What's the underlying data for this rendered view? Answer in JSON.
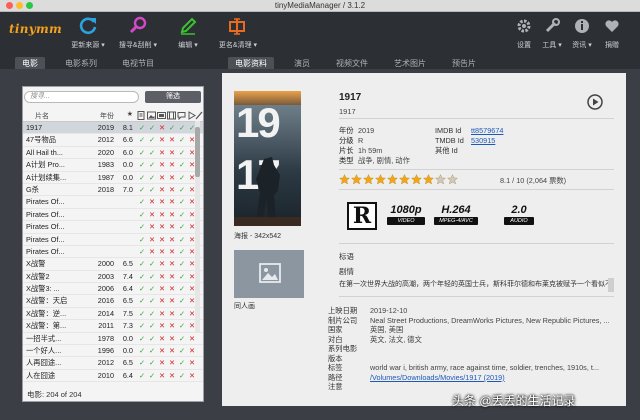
{
  "window": {
    "title": "tinyMediaManager / 3.1.2"
  },
  "toolbar": {
    "logo": "tinymm",
    "buttons": [
      {
        "label": "更新来源 ▾",
        "icon": "refresh-icon",
        "color": "#2aa3e0"
      },
      {
        "label": "搜寻&刮削 ▾",
        "icon": "search-icon",
        "color": "#d548c9"
      },
      {
        "label": "编辑 ▾",
        "icon": "pencil-icon",
        "color": "#39c42f"
      },
      {
        "label": "更名&清理 ▾",
        "icon": "rename-icon",
        "color": "#ea6b1f"
      }
    ],
    "right_buttons": [
      {
        "label": "设置",
        "icon": "gear-icon"
      },
      {
        "label": "工具 ▾",
        "icon": "wrench-icon"
      },
      {
        "label": "资讯 ▾",
        "icon": "info-icon"
      },
      {
        "label": "捐赠",
        "icon": "heart-icon"
      }
    ]
  },
  "left_tabs": [
    "电影",
    "电影系列",
    "电视节目"
  ],
  "right_tabs": [
    "电影资料",
    "演员",
    "视频文件",
    "艺术图片",
    "预告片"
  ],
  "list": {
    "search_placeholder": "搜寻...",
    "filter_label": "筛选",
    "headers": {
      "title": "片名",
      "year": "年份",
      "rating": "★"
    },
    "rows": [
      {
        "title": "1917",
        "year": "2019",
        "rating": "8.1",
        "flags": [
          1,
          1,
          0,
          1,
          1,
          1
        ]
      },
      {
        "title": "47号物品",
        "year": "2012",
        "rating": "6.6",
        "flags": [
          1,
          1,
          0,
          0,
          1,
          0
        ]
      },
      {
        "title": "All Hail th...",
        "year": "2020",
        "rating": "6.0",
        "flags": [
          1,
          1,
          0,
          0,
          1,
          0
        ]
      },
      {
        "title": "A计划 Pro...",
        "year": "1983",
        "rating": "0.0",
        "flags": [
          1,
          1,
          0,
          0,
          1,
          0
        ]
      },
      {
        "title": "A计划续集...",
        "year": "1987",
        "rating": "0.0",
        "flags": [
          1,
          1,
          0,
          0,
          1,
          0
        ]
      },
      {
        "title": "G杀",
        "year": "2018",
        "rating": "7.0",
        "flags": [
          1,
          1,
          0,
          0,
          1,
          0
        ]
      },
      {
        "title": "Pirates Of...",
        "year": "",
        "rating": "",
        "flags": [
          1,
          0,
          0,
          0,
          1,
          0
        ]
      },
      {
        "title": "Pirates Of...",
        "year": "",
        "rating": "",
        "flags": [
          1,
          0,
          0,
          0,
          1,
          0
        ]
      },
      {
        "title": "Pirates Of...",
        "year": "",
        "rating": "",
        "flags": [
          1,
          0,
          0,
          0,
          1,
          0
        ]
      },
      {
        "title": "Pirates Of...",
        "year": "",
        "rating": "",
        "flags": [
          1,
          0,
          0,
          0,
          1,
          0
        ]
      },
      {
        "title": "Pirates Of...",
        "year": "",
        "rating": "",
        "flags": [
          1,
          0,
          0,
          0,
          1,
          0
        ]
      },
      {
        "title": "X战警",
        "year": "2000",
        "rating": "6.5",
        "flags": [
          1,
          1,
          0,
          0,
          1,
          0
        ]
      },
      {
        "title": "X战警2",
        "year": "2003",
        "rating": "7.4",
        "flags": [
          1,
          1,
          0,
          0,
          1,
          0
        ]
      },
      {
        "title": "X战警3: ...",
        "year": "2006",
        "rating": "6.4",
        "flags": [
          1,
          1,
          0,
          0,
          1,
          0
        ]
      },
      {
        "title": "X战警：天启",
        "year": "2016",
        "rating": "6.5",
        "flags": [
          1,
          1,
          0,
          0,
          1,
          0
        ]
      },
      {
        "title": "X战警：逆...",
        "year": "2014",
        "rating": "7.5",
        "flags": [
          1,
          1,
          0,
          0,
          1,
          0
        ]
      },
      {
        "title": "X战警：第...",
        "year": "2011",
        "rating": "7.3",
        "flags": [
          1,
          1,
          0,
          0,
          1,
          0
        ]
      },
      {
        "title": "一招半式...",
        "year": "1978",
        "rating": "0.0",
        "flags": [
          1,
          1,
          0,
          0,
          1,
          0
        ]
      },
      {
        "title": "一个好人...",
        "year": "1996",
        "rating": "0.0",
        "flags": [
          1,
          1,
          0,
          0,
          1,
          0
        ]
      },
      {
        "title": "人再囧途...",
        "year": "2012",
        "rating": "6.5",
        "flags": [
          1,
          1,
          0,
          0,
          1,
          0
        ]
      },
      {
        "title": "人在囧途",
        "year": "2010",
        "rating": "6.4",
        "flags": [
          1,
          1,
          0,
          0,
          1,
          0
        ]
      }
    ],
    "count_label": "电影: 204 of 204"
  },
  "detail": {
    "title": "1917",
    "subtitle": "1917",
    "year_label": "年份",
    "year": "2019",
    "cert_label": "分级",
    "cert": "R",
    "runtime_label": "片长",
    "runtime": "1h 59m",
    "genre_label": "类型",
    "genres": "战争, 剧情, 动作",
    "imdb_label": "IMDB Id",
    "imdb": "tt8579674",
    "tmdb_label": "TMDB Id",
    "tmdb": "530915",
    "other_label": "其他 Id",
    "other": "",
    "rating": 8.1,
    "rating_text": "8.1 / 10 (2,064 票数)",
    "poster_caption": "海报 - 342x542",
    "poster_text": [
      "19",
      "17"
    ],
    "fanart_caption": "同人画",
    "media": {
      "cert_letter": "R",
      "resolution": "1080p",
      "resolution_sub": "VIDEO",
      "codec": "H.264",
      "codec_sub": "MPEG-4/AVC",
      "audio": "2.0",
      "audio_sub": "AUDIO"
    },
    "tagline_label": "标语",
    "plot_label": "剧情",
    "plot": "在第一次世界大战的高潮，两个年轻的英国士兵，斯科菲尔德和布莱克被赋予一个看似不可能完成的任务。",
    "release_label": "上映日期",
    "release": "2019-12-10",
    "studio_label": "制片公司",
    "studio": "Neal Street Productions, DreamWorks Pictures, New Republic Pictures, ...",
    "country_label": "国家",
    "country": "英国, 美国",
    "spoken_label": "对白",
    "spoken": "英文, 法文, 德文",
    "set_label": "系列电影",
    "set": "",
    "version_label": "版本",
    "version": "",
    "tags_label": "标签",
    "tags": "world war i, british army, race against time, soldier, trenches, 1910s, t...",
    "path_label": "路径",
    "path": "/Volumes/Downloads/Movies/1917 (2019)",
    "note_label": "注意",
    "note": ""
  },
  "watermark": "头条 @丢丢的生活记录"
}
